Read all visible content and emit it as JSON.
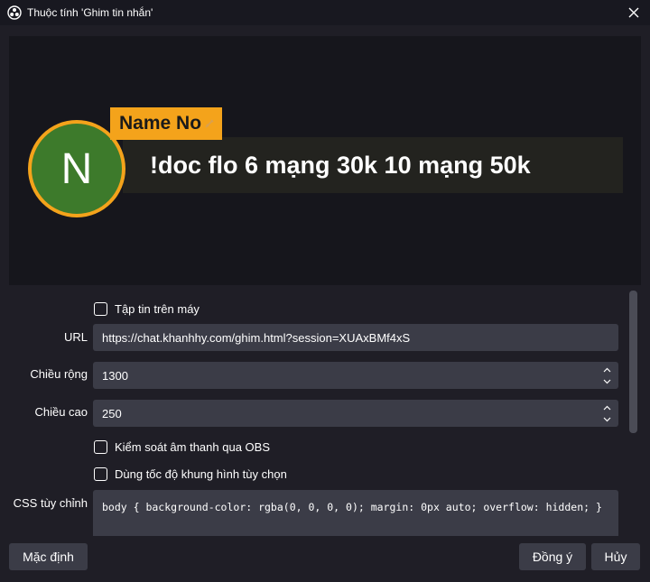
{
  "window": {
    "title": "Thuộc tính 'Ghim tin nhắn'",
    "app_icon": "obs-logo-icon",
    "close_icon": "close-icon"
  },
  "preview": {
    "avatar_letter": "N",
    "name": "Name No",
    "message": "!doc flo 6 mạng 30k 10 mạng 50k",
    "colors": {
      "accent": "#f4a31b",
      "avatar_bg": "#3d7a2b",
      "message_bg": "#23231f"
    }
  },
  "form": {
    "local_file": {
      "label": "Tập tin trên máy",
      "checked": false
    },
    "url": {
      "label": "URL",
      "value": "https://chat.khanhhy.com/ghim.html?session=XUAxBMf4xS"
    },
    "width": {
      "label": "Chiều rộng",
      "value": "1300"
    },
    "height": {
      "label": "Chiều cao",
      "value": "250"
    },
    "audio_control": {
      "label": "Kiểm soát âm thanh qua OBS",
      "checked": false
    },
    "custom_fps": {
      "label": "Dùng tốc độ khung hình tùy chọn",
      "checked": false
    },
    "css": {
      "label": "CSS tùy chỉnh",
      "value": "body { background-color: rgba(0, 0, 0, 0); margin: 0px auto; overflow: hidden; }"
    }
  },
  "buttons": {
    "defaults": "Mặc định",
    "ok": "Đồng ý",
    "cancel": "Hủy"
  }
}
